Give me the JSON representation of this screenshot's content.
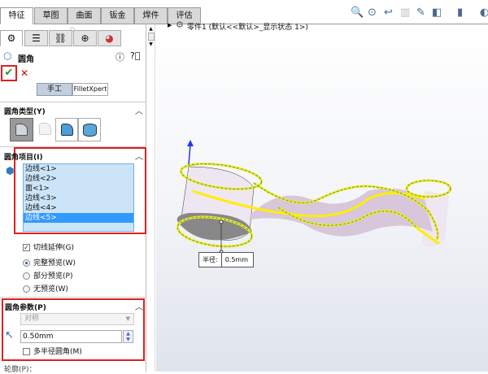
{
  "tabs": [
    "特征",
    "草图",
    "曲面",
    "钣金",
    "焊件",
    "评估"
  ],
  "panel": {
    "title": "圆角",
    "mode_buttons": [
      "手工",
      "FilletXpert"
    ],
    "fillet_type": {
      "label": "圆角类型(Y)"
    },
    "fillet_items": {
      "label": "圆角项目(I)",
      "items": [
        "边线<1>",
        "边线<2>",
        "面<1>",
        "边线<3>",
        "边线<4>",
        "边线<5>"
      ],
      "selected_index": 5
    },
    "tangent_propagation": {
      "label": "切线延伸(G)",
      "checked": true
    },
    "preview": {
      "options": [
        "完整预览(W)",
        "部分预览(P)",
        "无预览(W)"
      ],
      "selected_index": 0
    },
    "fillet_params": {
      "label": "圆角参数(P)",
      "profile_select": "对称",
      "radius_value": "0.50mm",
      "multi_radius": {
        "label": "多半径圆角(M)",
        "checked": false
      }
    },
    "profile_label": "轮廓(P)："
  },
  "tree": {
    "root": "零件1",
    "config": "(默认<<默认>_显示状态 1>)"
  },
  "callout": {
    "label": "半径:",
    "value": "0.5mm"
  },
  "colors": {
    "accent": "#3399ff",
    "highlight": "#ffee00",
    "red_box": "#e02020"
  }
}
